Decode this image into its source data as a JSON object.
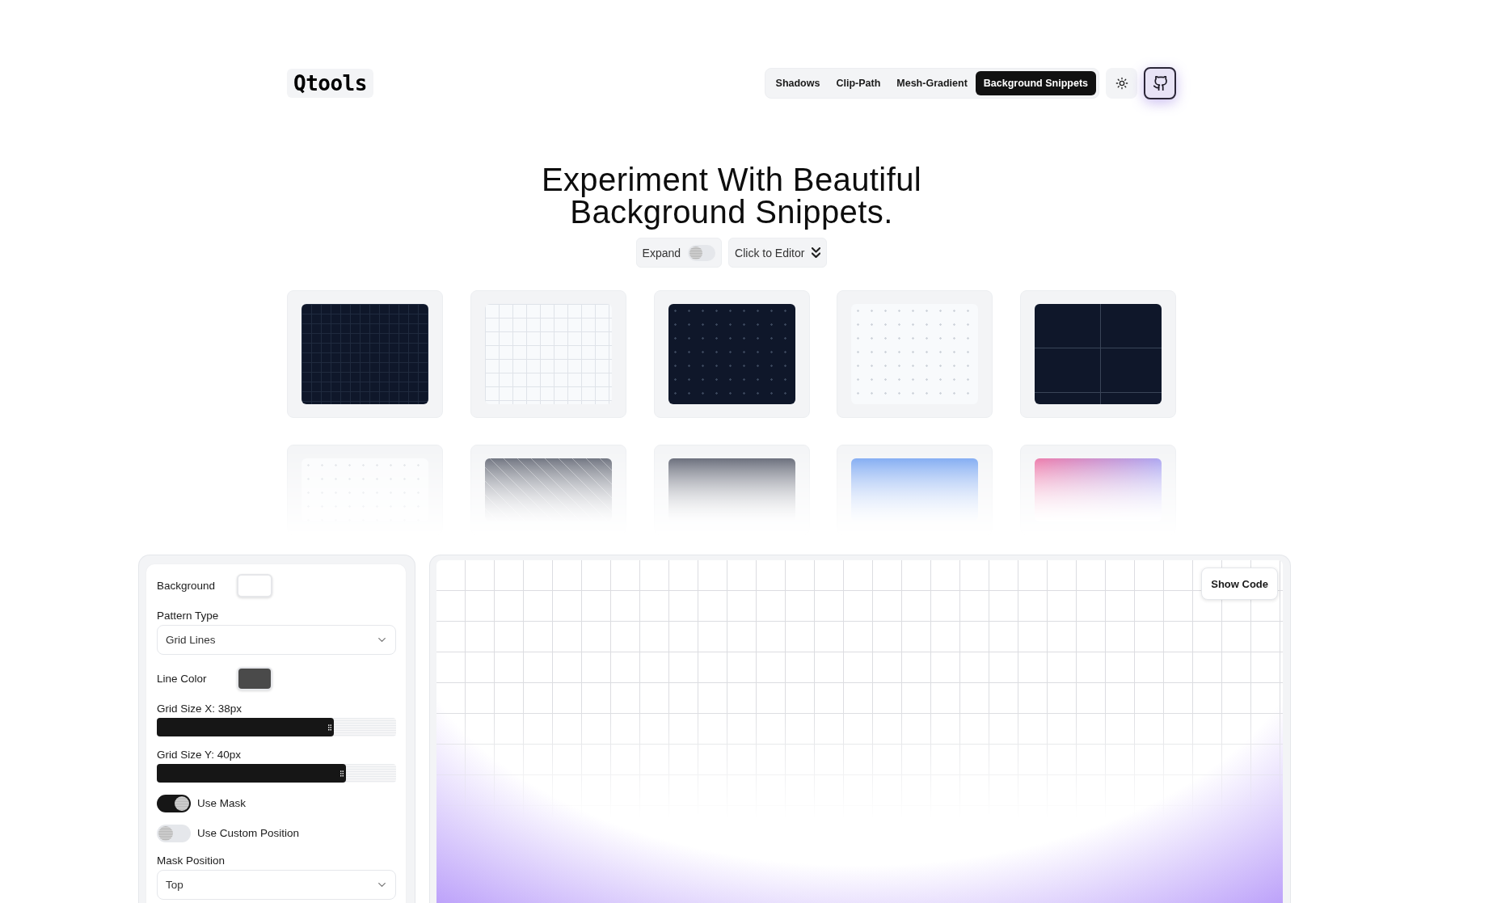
{
  "header": {
    "logo": "Qtools",
    "nav": [
      {
        "label": "Shadows",
        "selected": false
      },
      {
        "label": "Clip-Path",
        "selected": false
      },
      {
        "label": "Mesh-Gradient",
        "selected": false
      },
      {
        "label": "Background Snippets",
        "selected": true
      }
    ]
  },
  "hero": {
    "title_lines": [
      "Experiment With Beautiful",
      "Background Snippets."
    ],
    "expand": {
      "label": "Expand",
      "on": false
    },
    "editor_link": {
      "label": "Click to Editor"
    }
  },
  "snippets": [
    {
      "kind": "darkgrid"
    },
    {
      "kind": "lightgrid"
    },
    {
      "kind": "darkdots"
    },
    {
      "kind": "lightdots"
    },
    {
      "kind": "darkquad"
    },
    {
      "kind": "fadedots"
    },
    {
      "kind": "stripes"
    },
    {
      "kind": "slate"
    },
    {
      "kind": "sky"
    },
    {
      "kind": "rose"
    }
  ],
  "editor": {
    "controls": [
      {
        "kind": "color",
        "label": "Background",
        "color": "#ffffff"
      },
      {
        "kind": "select",
        "label": "Pattern Type",
        "value": "Grid Lines"
      },
      {
        "kind": "color",
        "label": "Line Color",
        "color": "#4a4a4a"
      },
      {
        "kind": "slider",
        "label": "Grid Size X: 38px",
        "level": 0.74
      },
      {
        "kind": "slider",
        "label": "Grid Size Y: 40px",
        "level": 0.79
      },
      {
        "kind": "switch",
        "label": "Use Mask",
        "on": true
      },
      {
        "kind": "switch",
        "label": "Use Custom Position",
        "on": false
      },
      {
        "kind": "select",
        "label": "Mask Position",
        "value": "Top"
      }
    ],
    "preview": {
      "button": "Show Code"
    }
  }
}
